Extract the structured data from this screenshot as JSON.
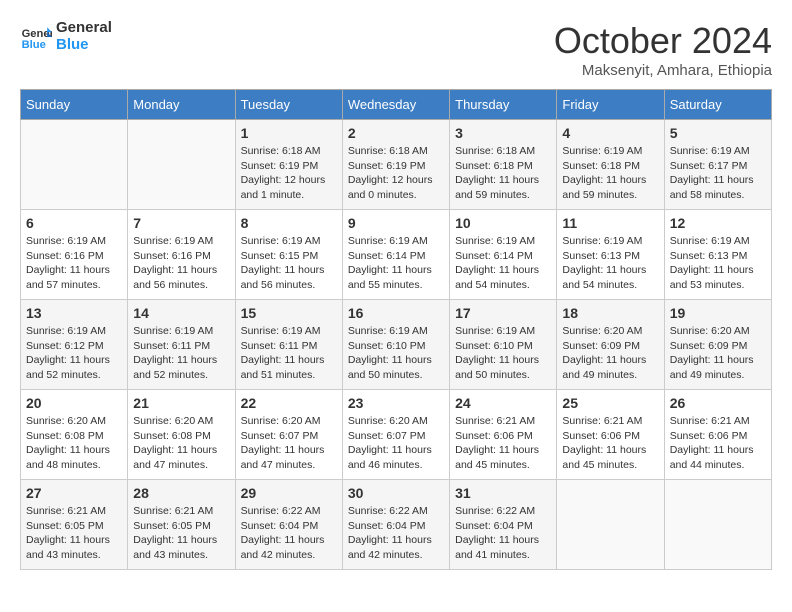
{
  "header": {
    "logo_line1": "General",
    "logo_line2": "Blue",
    "month_title": "October 2024",
    "subtitle": "Maksenyit, Amhara, Ethiopia"
  },
  "days_of_week": [
    "Sunday",
    "Monday",
    "Tuesday",
    "Wednesday",
    "Thursday",
    "Friday",
    "Saturday"
  ],
  "weeks": [
    [
      {
        "day": "",
        "info": ""
      },
      {
        "day": "",
        "info": ""
      },
      {
        "day": "1",
        "info": "Sunrise: 6:18 AM\nSunset: 6:19 PM\nDaylight: 12 hours and 1 minute."
      },
      {
        "day": "2",
        "info": "Sunrise: 6:18 AM\nSunset: 6:19 PM\nDaylight: 12 hours and 0 minutes."
      },
      {
        "day": "3",
        "info": "Sunrise: 6:18 AM\nSunset: 6:18 PM\nDaylight: 11 hours and 59 minutes."
      },
      {
        "day": "4",
        "info": "Sunrise: 6:19 AM\nSunset: 6:18 PM\nDaylight: 11 hours and 59 minutes."
      },
      {
        "day": "5",
        "info": "Sunrise: 6:19 AM\nSunset: 6:17 PM\nDaylight: 11 hours and 58 minutes."
      }
    ],
    [
      {
        "day": "6",
        "info": "Sunrise: 6:19 AM\nSunset: 6:16 PM\nDaylight: 11 hours and 57 minutes."
      },
      {
        "day": "7",
        "info": "Sunrise: 6:19 AM\nSunset: 6:16 PM\nDaylight: 11 hours and 56 minutes."
      },
      {
        "day": "8",
        "info": "Sunrise: 6:19 AM\nSunset: 6:15 PM\nDaylight: 11 hours and 56 minutes."
      },
      {
        "day": "9",
        "info": "Sunrise: 6:19 AM\nSunset: 6:14 PM\nDaylight: 11 hours and 55 minutes."
      },
      {
        "day": "10",
        "info": "Sunrise: 6:19 AM\nSunset: 6:14 PM\nDaylight: 11 hours and 54 minutes."
      },
      {
        "day": "11",
        "info": "Sunrise: 6:19 AM\nSunset: 6:13 PM\nDaylight: 11 hours and 54 minutes."
      },
      {
        "day": "12",
        "info": "Sunrise: 6:19 AM\nSunset: 6:13 PM\nDaylight: 11 hours and 53 minutes."
      }
    ],
    [
      {
        "day": "13",
        "info": "Sunrise: 6:19 AM\nSunset: 6:12 PM\nDaylight: 11 hours and 52 minutes."
      },
      {
        "day": "14",
        "info": "Sunrise: 6:19 AM\nSunset: 6:11 PM\nDaylight: 11 hours and 52 minutes."
      },
      {
        "day": "15",
        "info": "Sunrise: 6:19 AM\nSunset: 6:11 PM\nDaylight: 11 hours and 51 minutes."
      },
      {
        "day": "16",
        "info": "Sunrise: 6:19 AM\nSunset: 6:10 PM\nDaylight: 11 hours and 50 minutes."
      },
      {
        "day": "17",
        "info": "Sunrise: 6:19 AM\nSunset: 6:10 PM\nDaylight: 11 hours and 50 minutes."
      },
      {
        "day": "18",
        "info": "Sunrise: 6:20 AM\nSunset: 6:09 PM\nDaylight: 11 hours and 49 minutes."
      },
      {
        "day": "19",
        "info": "Sunrise: 6:20 AM\nSunset: 6:09 PM\nDaylight: 11 hours and 49 minutes."
      }
    ],
    [
      {
        "day": "20",
        "info": "Sunrise: 6:20 AM\nSunset: 6:08 PM\nDaylight: 11 hours and 48 minutes."
      },
      {
        "day": "21",
        "info": "Sunrise: 6:20 AM\nSunset: 6:08 PM\nDaylight: 11 hours and 47 minutes."
      },
      {
        "day": "22",
        "info": "Sunrise: 6:20 AM\nSunset: 6:07 PM\nDaylight: 11 hours and 47 minutes."
      },
      {
        "day": "23",
        "info": "Sunrise: 6:20 AM\nSunset: 6:07 PM\nDaylight: 11 hours and 46 minutes."
      },
      {
        "day": "24",
        "info": "Sunrise: 6:21 AM\nSunset: 6:06 PM\nDaylight: 11 hours and 45 minutes."
      },
      {
        "day": "25",
        "info": "Sunrise: 6:21 AM\nSunset: 6:06 PM\nDaylight: 11 hours and 45 minutes."
      },
      {
        "day": "26",
        "info": "Sunrise: 6:21 AM\nSunset: 6:06 PM\nDaylight: 11 hours and 44 minutes."
      }
    ],
    [
      {
        "day": "27",
        "info": "Sunrise: 6:21 AM\nSunset: 6:05 PM\nDaylight: 11 hours and 43 minutes."
      },
      {
        "day": "28",
        "info": "Sunrise: 6:21 AM\nSunset: 6:05 PM\nDaylight: 11 hours and 43 minutes."
      },
      {
        "day": "29",
        "info": "Sunrise: 6:22 AM\nSunset: 6:04 PM\nDaylight: 11 hours and 42 minutes."
      },
      {
        "day": "30",
        "info": "Sunrise: 6:22 AM\nSunset: 6:04 PM\nDaylight: 11 hours and 42 minutes."
      },
      {
        "day": "31",
        "info": "Sunrise: 6:22 AM\nSunset: 6:04 PM\nDaylight: 11 hours and 41 minutes."
      },
      {
        "day": "",
        "info": ""
      },
      {
        "day": "",
        "info": ""
      }
    ]
  ]
}
